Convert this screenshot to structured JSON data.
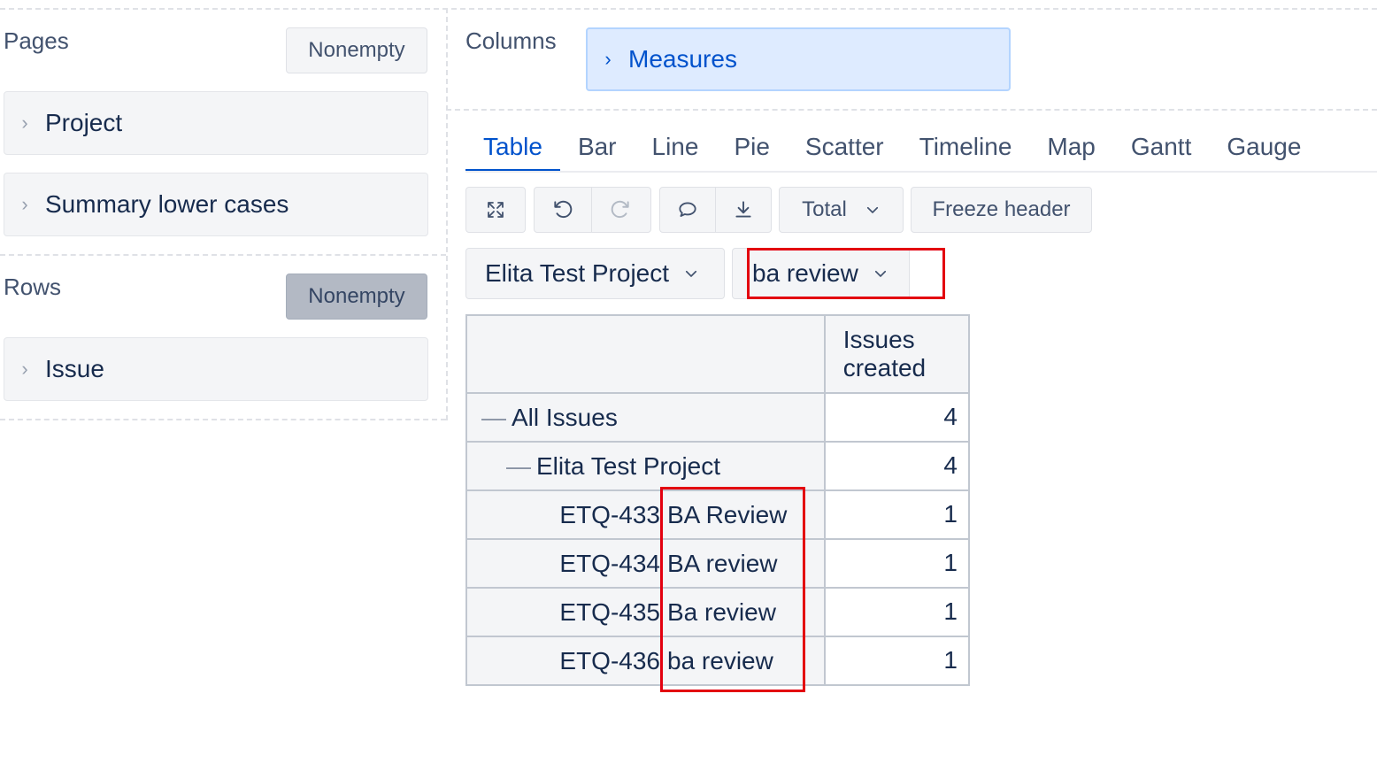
{
  "pages": {
    "title": "Pages",
    "nonempty_label": "Nonempty",
    "items": [
      "Project",
      "Summary lower cases"
    ]
  },
  "rows": {
    "title": "Rows",
    "nonempty_label": "Nonempty",
    "items": [
      "Issue"
    ]
  },
  "columns": {
    "title": "Columns",
    "items": [
      "Measures"
    ]
  },
  "tabs": [
    "Table",
    "Bar",
    "Line",
    "Pie",
    "Scatter",
    "Timeline",
    "Map",
    "Gantt",
    "Gauge"
  ],
  "active_tab": "Table",
  "toolbar": {
    "total_label": "Total",
    "freeze_label": "Freeze header"
  },
  "filters": {
    "project": "Elita Test Project",
    "summary": "ba review"
  },
  "table": {
    "column_header": "Issues created",
    "rows": [
      {
        "level": 0,
        "key": "",
        "label": "All Issues",
        "value": "4"
      },
      {
        "level": 1,
        "key": "",
        "label": "Elita Test Project",
        "value": "4"
      },
      {
        "level": 2,
        "key": "ETQ-433",
        "label": "BA Review",
        "value": "1"
      },
      {
        "level": 2,
        "key": "ETQ-434",
        "label": "BA review",
        "value": "1"
      },
      {
        "level": 2,
        "key": "ETQ-435",
        "label": "Ba review",
        "value": "1"
      },
      {
        "level": 2,
        "key": "ETQ-436",
        "label": "ba review",
        "value": "1"
      }
    ]
  }
}
